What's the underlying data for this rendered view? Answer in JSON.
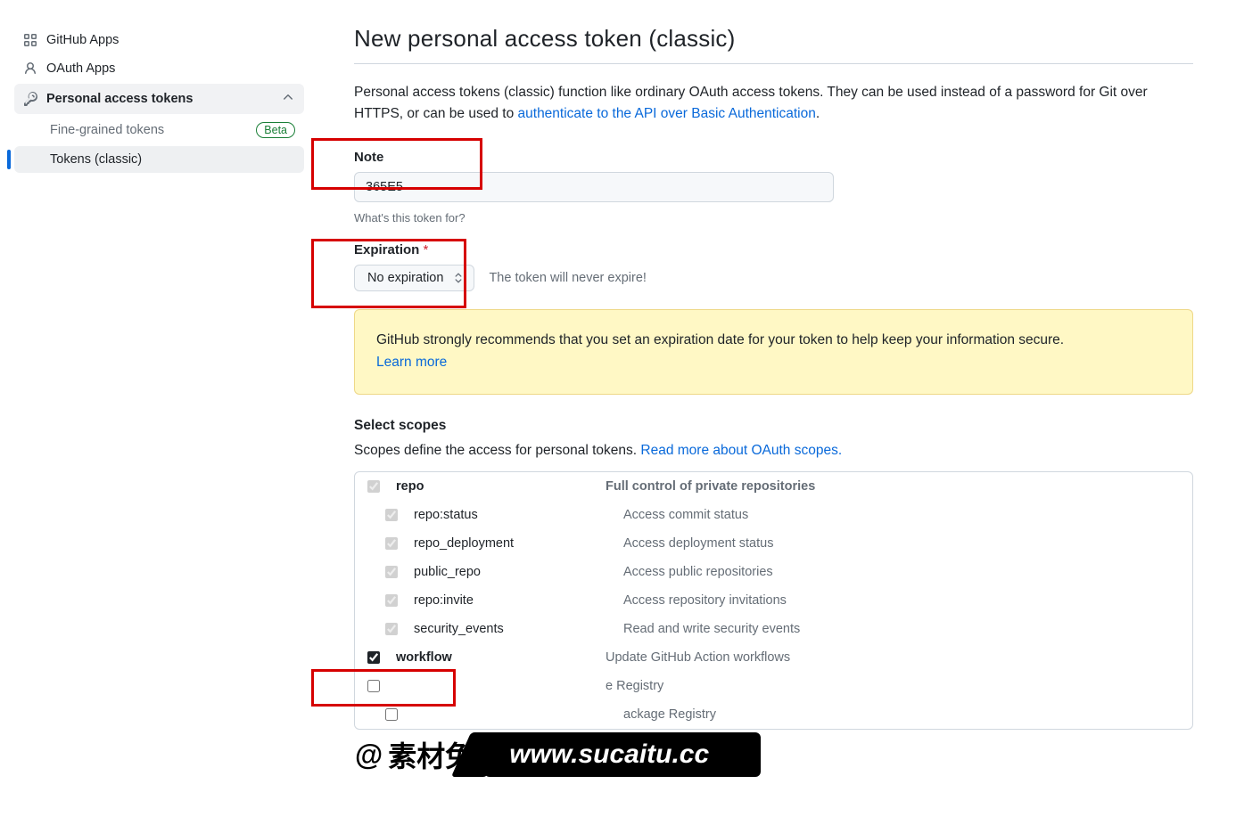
{
  "sidebar": {
    "items": [
      {
        "icon": "apps",
        "label": "GitHub Apps"
      },
      {
        "icon": "person",
        "label": "OAuth Apps"
      },
      {
        "icon": "key",
        "label": "Personal access tokens",
        "expanded": true
      }
    ],
    "subitems": [
      {
        "label": "Fine-grained tokens",
        "badge": "Beta"
      },
      {
        "label": "Tokens (classic)",
        "selected": true
      }
    ]
  },
  "page": {
    "title": "New personal access token (classic)",
    "intro_prefix": "Personal access tokens (classic) function like ordinary OAuth access tokens. They can be used instead of a password for Git over HTTPS, or can be used to ",
    "intro_link": "authenticate to the API over Basic Authentication",
    "intro_suffix": "."
  },
  "form": {
    "note_label": "Note",
    "note_value": "365E5",
    "note_helper": "What's this token for?",
    "expiration_label": "Expiration",
    "expiration_value": "No expiration",
    "expiration_hint": "The token will never expire!",
    "warning_text": "GitHub strongly recommends that you set an expiration date for your token to help keep your information secure.",
    "warning_link": "Learn more",
    "scopes_heading": "Select scopes",
    "scopes_sub_prefix": "Scopes define the access for personal tokens. ",
    "scopes_sub_link": "Read more about OAuth scopes."
  },
  "scopes": {
    "groups": [
      {
        "name": "repo",
        "desc": "Full control of private repositories",
        "checked": true,
        "disabled": true,
        "children": [
          {
            "name": "repo:status",
            "desc": "Access commit status",
            "checked": true,
            "disabled": true
          },
          {
            "name": "repo_deployment",
            "desc": "Access deployment status",
            "checked": true,
            "disabled": true
          },
          {
            "name": "public_repo",
            "desc": "Access public repositories",
            "checked": true,
            "disabled": true
          },
          {
            "name": "repo:invite",
            "desc": "Access repository invitations",
            "checked": true,
            "disabled": true
          },
          {
            "name": "security_events",
            "desc": "Read and write security events",
            "checked": true,
            "disabled": true
          }
        ]
      },
      {
        "name": "workflow",
        "desc": "Update GitHub Action workflows",
        "checked": true,
        "disabled": false
      },
      {
        "name": "",
        "desc": "e Registry",
        "checked": false,
        "disabled": false,
        "children": [
          {
            "name": "",
            "desc": "ackage Registry",
            "checked": false,
            "disabled": false
          }
        ]
      }
    ]
  },
  "watermark": {
    "at": "@",
    "text": "素材兔",
    "url": "www.sucaitu.cc"
  }
}
